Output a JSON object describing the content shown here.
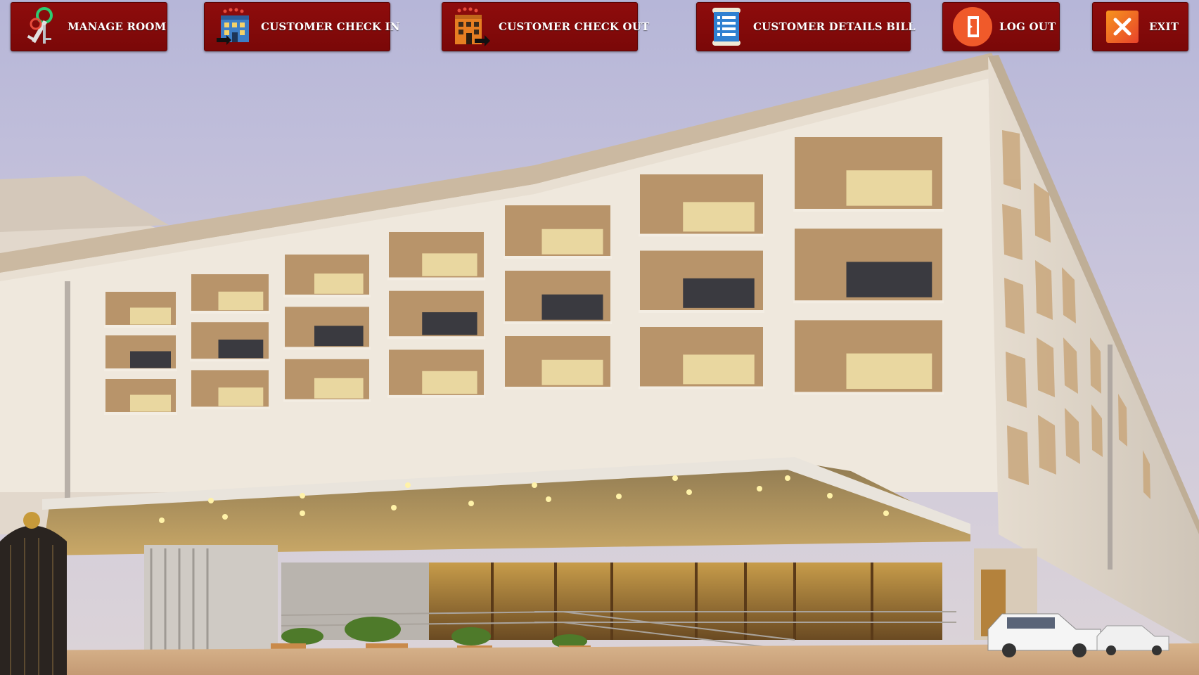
{
  "toolbar": {
    "manage_room": {
      "label": "MANAGE ROOM",
      "icon": "keys-icon"
    },
    "check_in": {
      "label": "CUSTOMER CHECK IN",
      "icon": "hotel-check-in-icon"
    },
    "check_out": {
      "label": "CUSTOMER CHECK OUT",
      "icon": "hotel-check-out-icon"
    },
    "details_bill": {
      "label": "CUSTOMER DETAILS BILL",
      "icon": "bill-scroll-icon"
    },
    "log_out": {
      "label": "LOG OUT",
      "icon": "logout-door-icon"
    },
    "exit": {
      "label": "EXIT",
      "icon": "close-x-icon"
    }
  },
  "colors": {
    "button_bg": "#8e0c0c",
    "button_text": "#ffffff",
    "sky": "#c9c6dc",
    "facade": "#ede6da",
    "balcony": "#b8946a"
  }
}
